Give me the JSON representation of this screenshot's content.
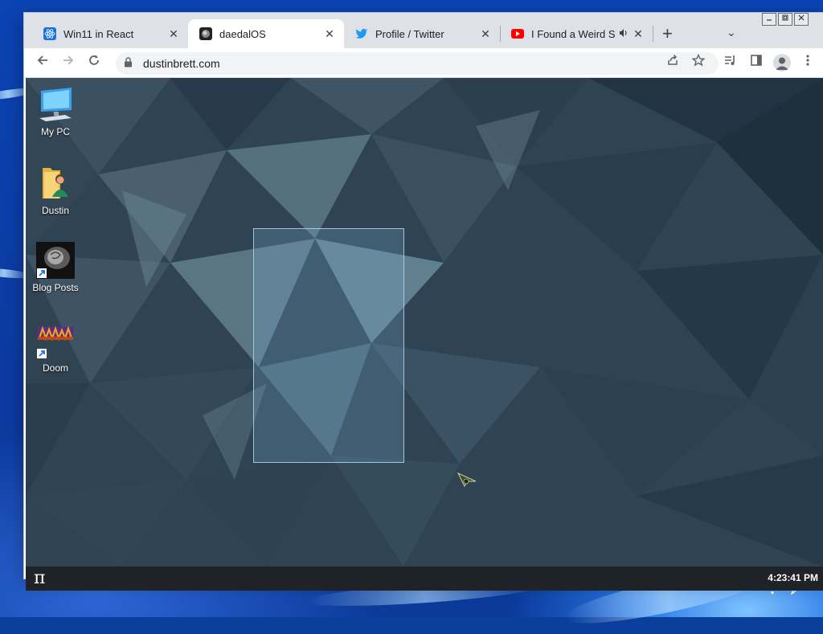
{
  "browser": {
    "tabs": [
      {
        "title": "Win11 in React",
        "favicon": "react-icon",
        "active": false
      },
      {
        "title": "daedalOS",
        "favicon": "daedalos-icon",
        "active": true
      },
      {
        "title": "Profile / Twitter",
        "favicon": "twitter-icon",
        "active": false
      },
      {
        "title": "I Found a Weird Sea",
        "favicon": "youtube-icon",
        "active": false,
        "audio": true
      }
    ],
    "new_tab_glyph": "+",
    "tab_search_glyph": "⌄",
    "close_glyph": "✕",
    "url": "dustinbrett.com",
    "accent": "#1a73e8"
  },
  "desktop": {
    "icons": [
      {
        "label": "My PC",
        "icon": "computer-icon"
      },
      {
        "label": "Dustin",
        "icon": "user-folder-icon"
      },
      {
        "label": "Blog Posts",
        "icon": "brain-shortcut-icon"
      },
      {
        "label": "Doom",
        "icon": "doom-shortcut-icon"
      }
    ]
  },
  "taskbar": {
    "start_glyph": "π",
    "clock": "4:23:41 PM"
  },
  "colors": {
    "wallpaper_base": "#2f4352",
    "taskbar": "#1f2328",
    "host_blue": "#0a43b3"
  }
}
